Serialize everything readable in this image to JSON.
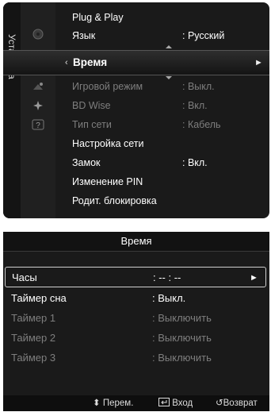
{
  "menu": {
    "category_label": "Установка",
    "items": [
      {
        "label": "Plug & Play",
        "value": "",
        "enabled": true
      },
      {
        "label": "Язык",
        "value": ": Русский",
        "enabled": true
      },
      {
        "label": "Время",
        "value": "",
        "enabled": true,
        "selected": true
      },
      {
        "label": "Игровой режим",
        "value": ": Выкл.",
        "enabled": false
      },
      {
        "label": "BD Wise",
        "value": ": Вкл.",
        "enabled": false
      },
      {
        "label": "Тип сети",
        "value": ": Кабель",
        "enabled": false
      },
      {
        "label": "Настройка сети",
        "value": "",
        "enabled": true
      },
      {
        "label": "Замок",
        "value": ": Вкл.",
        "enabled": true
      },
      {
        "label": "Изменение PIN",
        "value": "",
        "enabled": true
      },
      {
        "label": "Родит. блокировка",
        "value": "",
        "enabled": true
      }
    ],
    "selected_left_arrow": "‹",
    "selected_right_arrow": "►",
    "icons": [
      "disc-icon",
      "settings-gear-icon",
      "satellite-icon",
      "sparkle-icon",
      "help-icon"
    ]
  },
  "time_panel": {
    "title": "Время",
    "rows": [
      {
        "label": "Часы",
        "value": ": -- : --",
        "enabled": true,
        "selected": true
      },
      {
        "label": "Таймер сна",
        "value": ": Выкл.",
        "enabled": true
      },
      {
        "label": "Таймер 1",
        "value": ": Выключить",
        "enabled": false
      },
      {
        "label": "Таймер 2",
        "value": ": Выключить",
        "enabled": false
      },
      {
        "label": "Таймер 3",
        "value": ": Выключить",
        "enabled": false
      }
    ],
    "selected_arrow": "►"
  },
  "footer": {
    "move_label": "Перем.",
    "move_icon": "⬍",
    "enter_label": "Вход",
    "enter_icon": "enter-icon",
    "return_label": "Возврат",
    "return_icon": "↺"
  },
  "colors": {
    "background": "#1a1a1a",
    "text": "#ffffff",
    "disabled_text": "#7e7e7e"
  }
}
